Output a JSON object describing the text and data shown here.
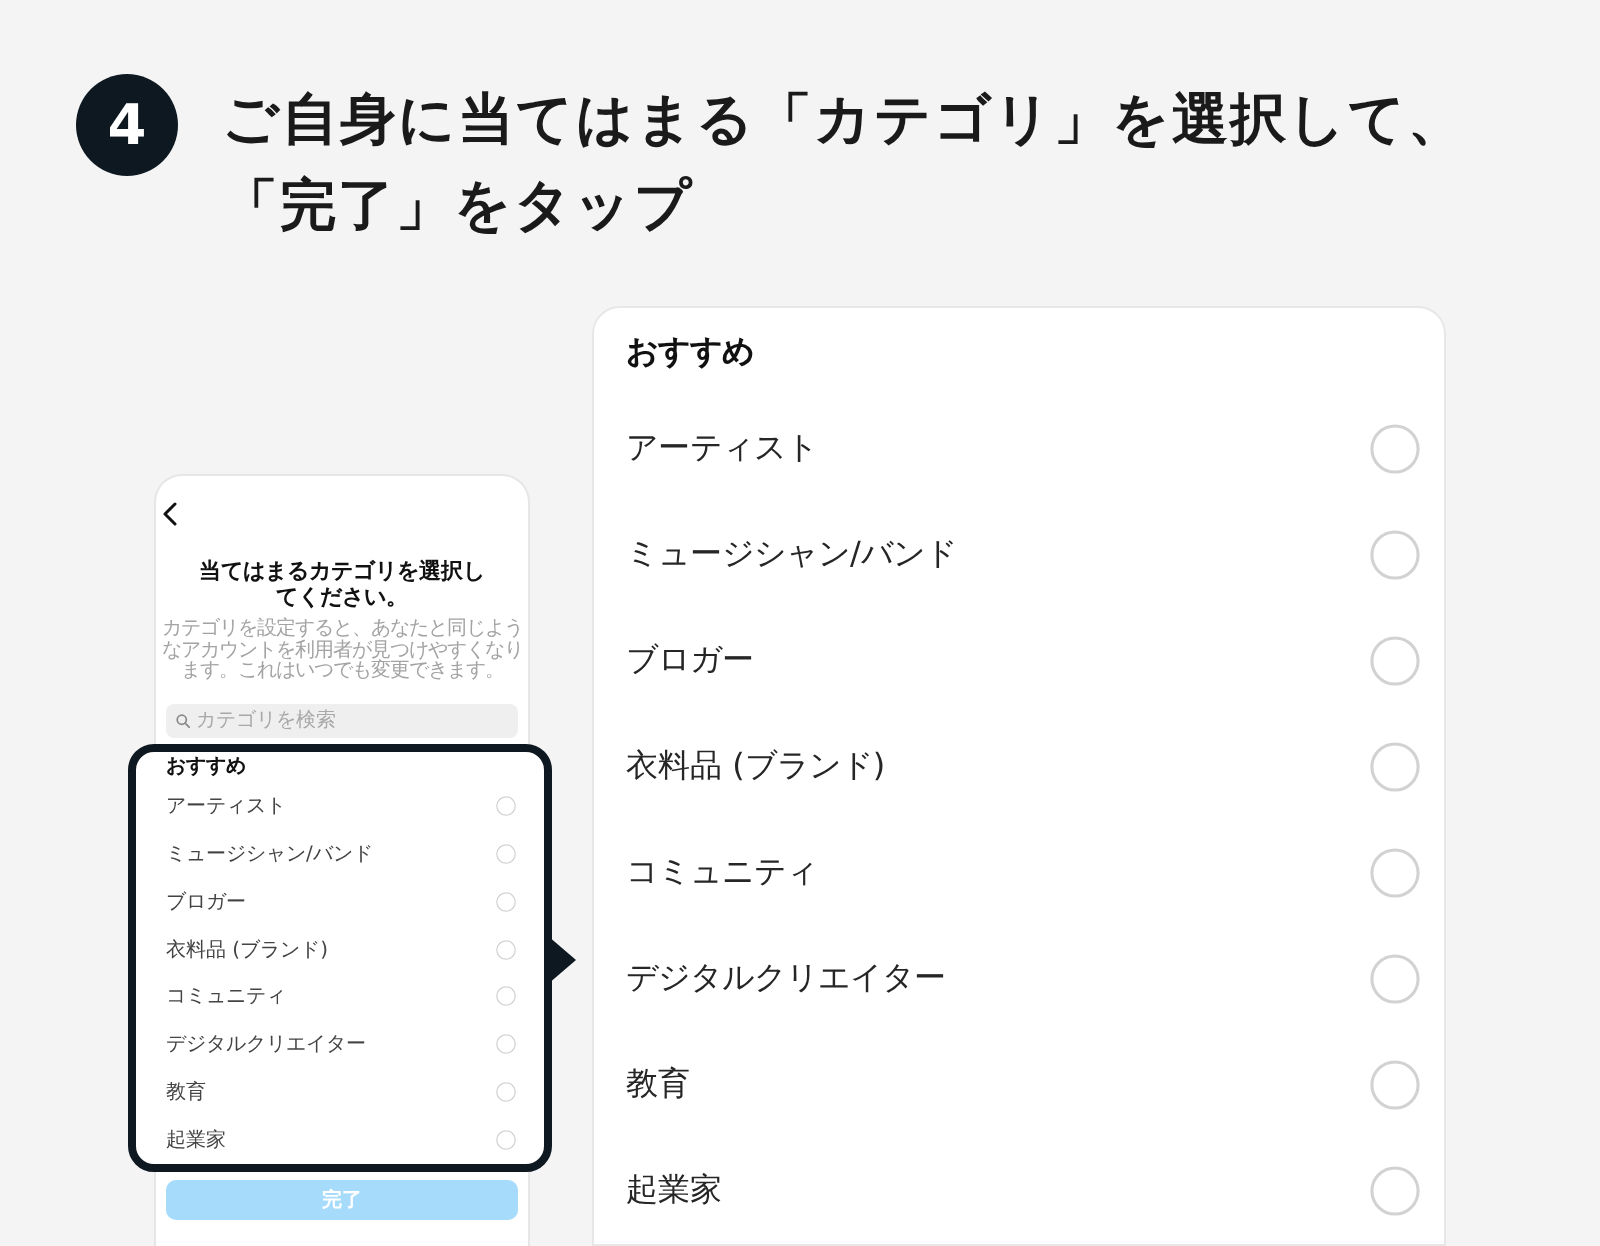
{
  "step": {
    "number": "4",
    "title": "ご自身に当てはまる「カテゴリ」を選択して、「完了」をタップ"
  },
  "phone": {
    "title": "当てはまるカテゴリを選択してください。",
    "description": "カテゴリを設定すると、あなたと同じようなアカウントを利用者が見つけやすくなります。これはいつでも変更できます。",
    "search": {
      "placeholder": "カテゴリを検索"
    },
    "section": "おすすめ",
    "categories": [
      {
        "label": "アーティスト",
        "selected": false
      },
      {
        "label": "ミュージシャン/バンド",
        "selected": false
      },
      {
        "label": "ブロガー",
        "selected": false
      },
      {
        "label": "衣料品 (ブランド)",
        "selected": false
      },
      {
        "label": "コミュニティ",
        "selected": false
      },
      {
        "label": "デジタルクリエイター",
        "selected": false
      },
      {
        "label": "教育",
        "selected": false
      },
      {
        "label": "起業家",
        "selected": false
      }
    ],
    "done_button": {
      "label": "完了",
      "disabled": true
    }
  },
  "panel": {
    "section": "おすすめ",
    "categories": [
      {
        "label": "アーティスト",
        "selected": false
      },
      {
        "label": "ミュージシャン/バンド",
        "selected": false
      },
      {
        "label": "ブロガー",
        "selected": false
      },
      {
        "label": "衣料品 (ブランド)",
        "selected": false
      },
      {
        "label": "コミュニティ",
        "selected": false
      },
      {
        "label": "デジタルクリエイター",
        "selected": false
      },
      {
        "label": "教育",
        "selected": false
      },
      {
        "label": "起業家",
        "selected": false
      }
    ]
  }
}
